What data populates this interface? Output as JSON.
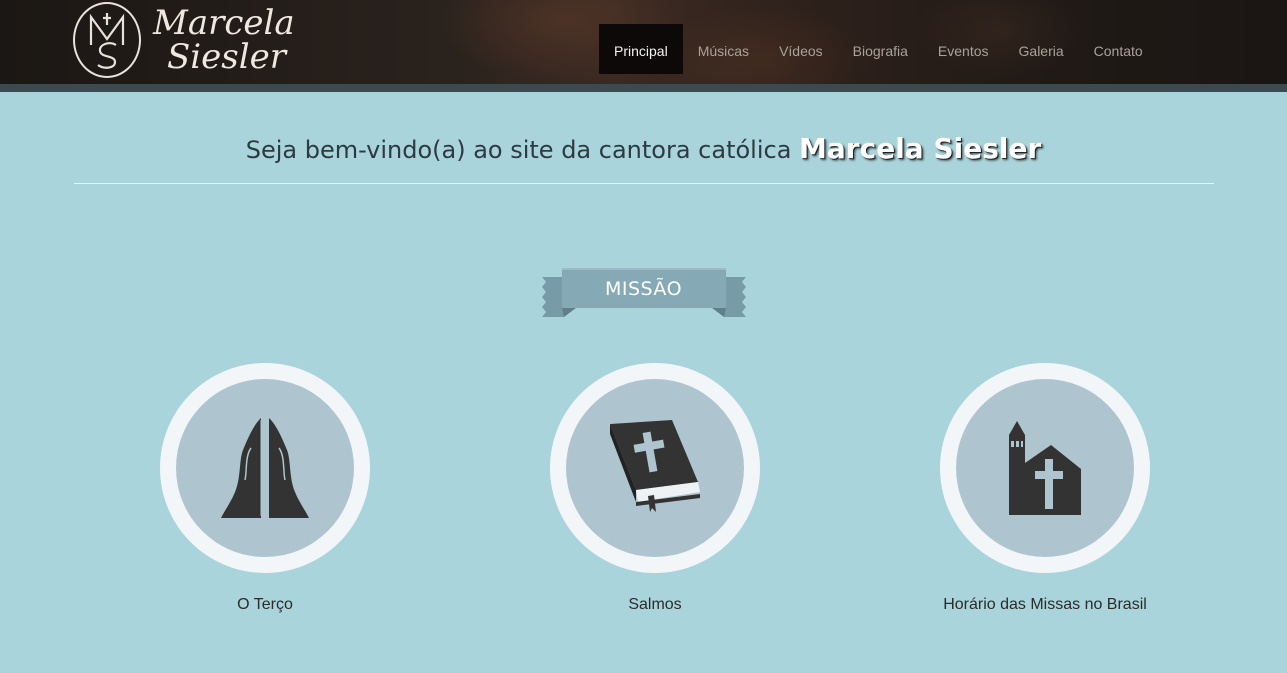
{
  "header": {
    "logo_monogram": "MS",
    "logo_line1": "Marcela",
    "logo_line2": "Siesler"
  },
  "nav": {
    "items": [
      {
        "label": "Principal",
        "active": true
      },
      {
        "label": "Músicas"
      },
      {
        "label": "Vídeos"
      },
      {
        "label": "Biografia"
      },
      {
        "label": "Eventos"
      },
      {
        "label": "Galeria"
      },
      {
        "label": "Contato"
      }
    ]
  },
  "welcome": {
    "text": "Seja bem-vindo(a) ao site da cantora católica",
    "name": "Marcela Siesler"
  },
  "section": {
    "title": "MISSÃO"
  },
  "cards": [
    {
      "label": "O Terço",
      "icon": "praying-hands-icon"
    },
    {
      "label": "Salmos",
      "icon": "bible-icon"
    },
    {
      "label": "Horário das Missas no Brasil",
      "icon": "church-icon"
    }
  ],
  "colors": {
    "page_bg": "#aad4dc",
    "ribbon": "#86a9b6",
    "icon_dark": "#333333",
    "ring": "#f3f6f8",
    "inner_circle": "#aec5cf"
  }
}
